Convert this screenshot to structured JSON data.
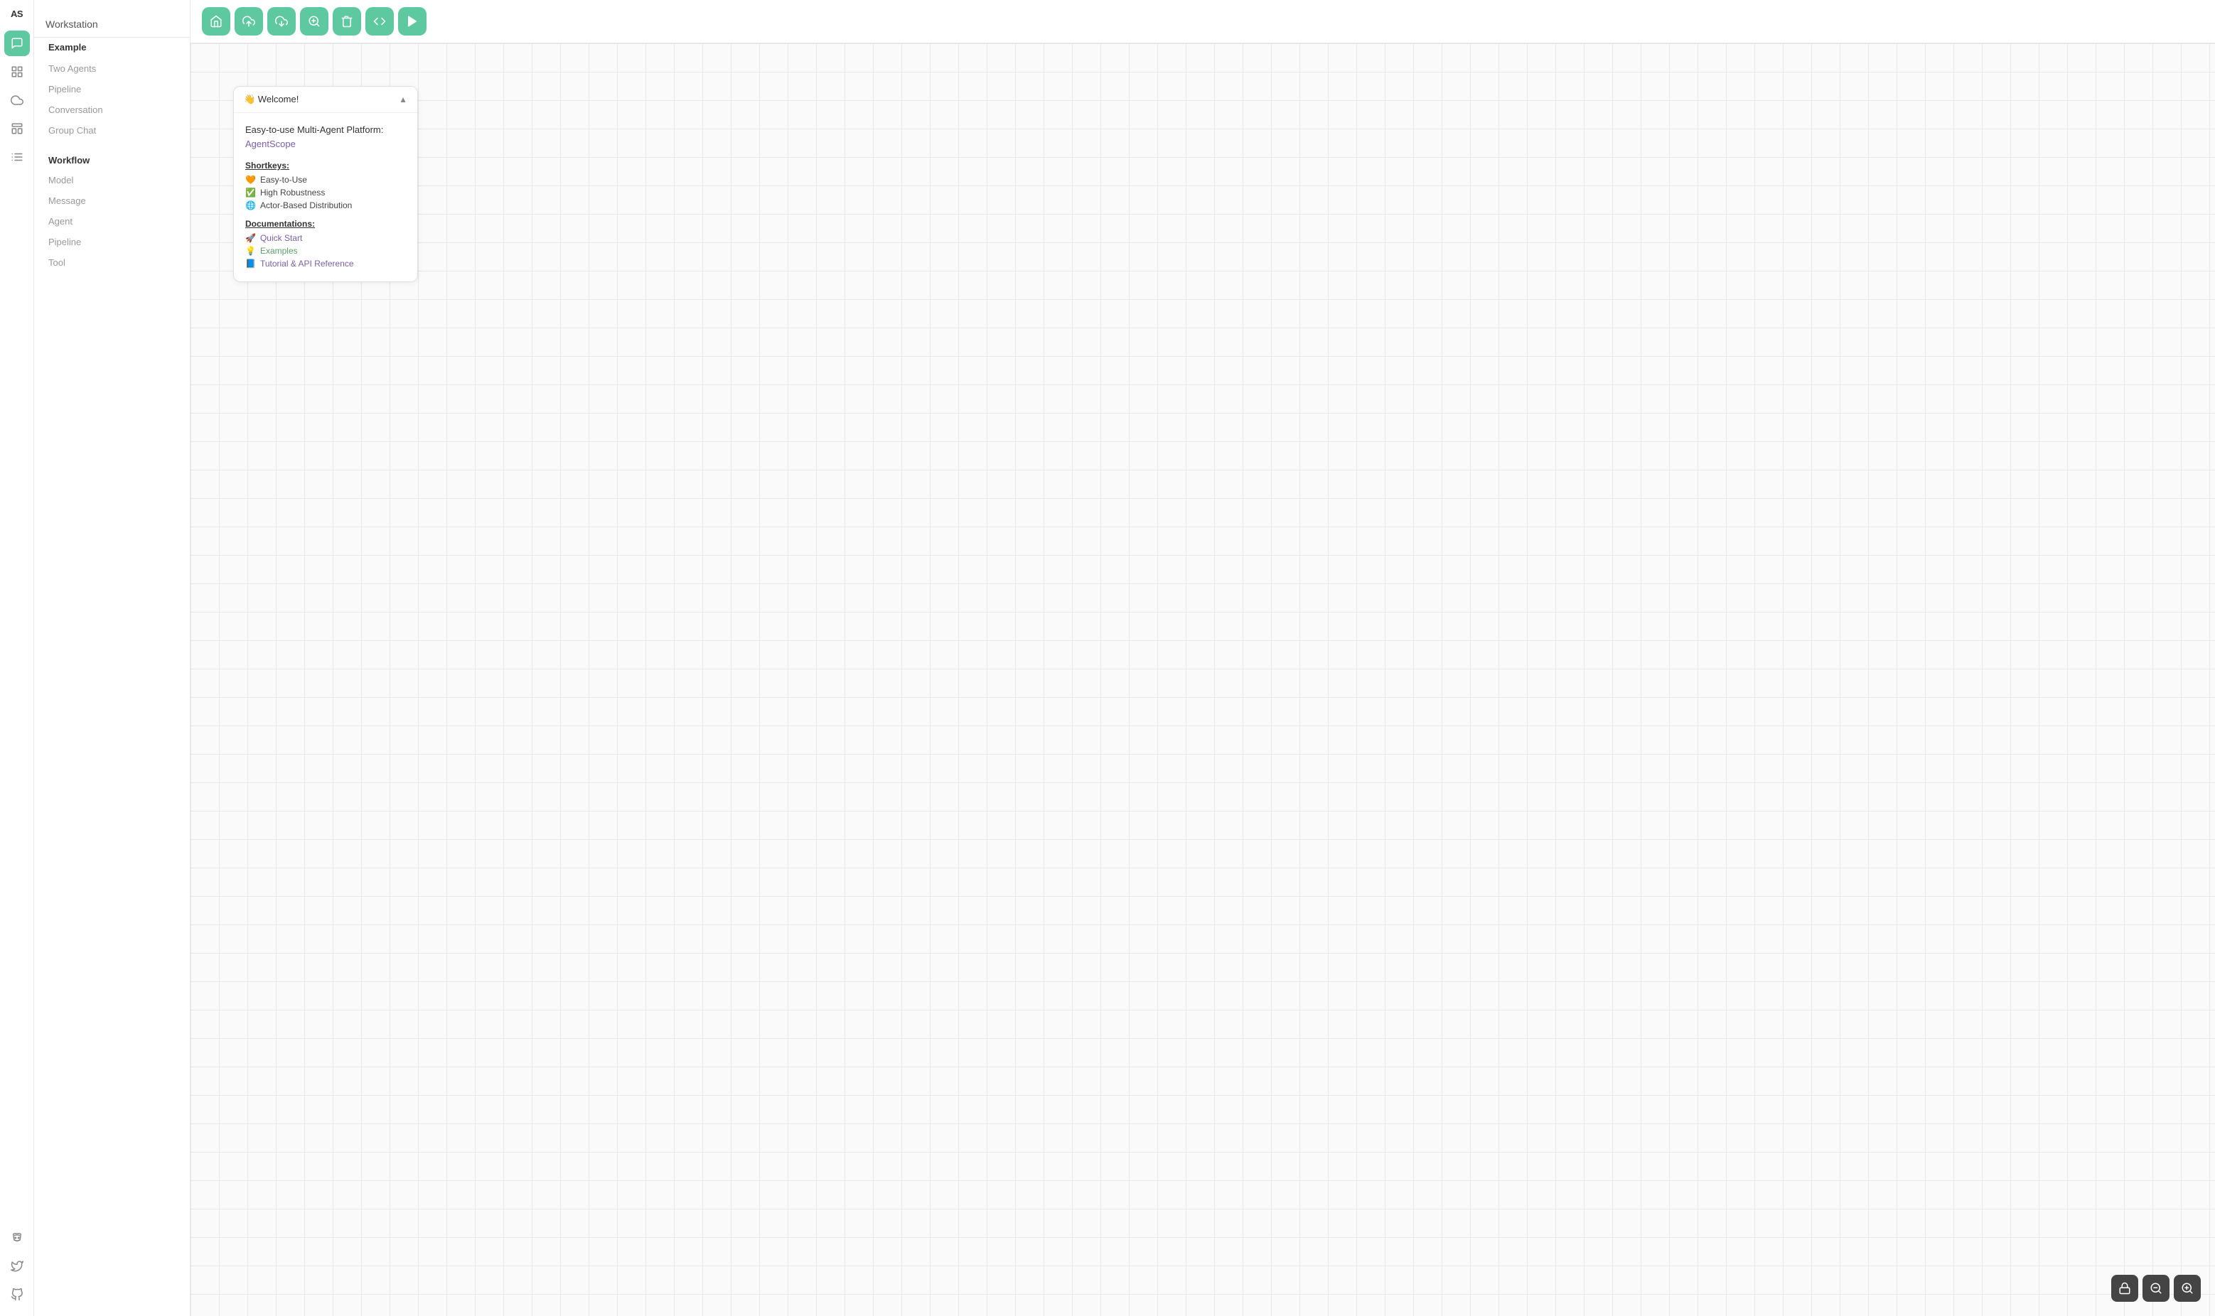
{
  "app": {
    "logo": "AS",
    "window_title": "Workstation"
  },
  "icon_sidebar": {
    "icons": [
      {
        "name": "chat-icon",
        "symbol": "💬",
        "active": true
      },
      {
        "name": "grid-icon",
        "symbol": "⊞",
        "active": false
      },
      {
        "name": "cloud-icon",
        "symbol": "☁",
        "active": false
      },
      {
        "name": "dashboard-icon",
        "symbol": "⊟",
        "active": false
      },
      {
        "name": "list-icon",
        "symbol": "☰",
        "active": false
      }
    ],
    "bottom_icons": [
      {
        "name": "discord-icon",
        "symbol": "🎮"
      },
      {
        "name": "bird-icon",
        "symbol": "🐦"
      },
      {
        "name": "github-icon",
        "symbol": "🐙"
      }
    ]
  },
  "sidebar": {
    "window_title": "Workstation",
    "example_section": {
      "label": "Example",
      "items": [
        {
          "label": "Two Agents"
        },
        {
          "label": "Pipeline"
        },
        {
          "label": "Conversation"
        },
        {
          "label": "Group Chat"
        }
      ]
    },
    "workflow_section": {
      "label": "Workflow",
      "items": [
        {
          "label": "Model"
        },
        {
          "label": "Message"
        },
        {
          "label": "Agent"
        },
        {
          "label": "Pipeline"
        },
        {
          "label": "Tool"
        }
      ]
    }
  },
  "toolbar": {
    "buttons": [
      {
        "name": "home-button",
        "label": "🏠"
      },
      {
        "name": "upload-button",
        "label": "⬆"
      },
      {
        "name": "download-button",
        "label": "⬇"
      },
      {
        "name": "zoom-fit-button",
        "label": "⊕"
      },
      {
        "name": "delete-button",
        "label": "🗑"
      },
      {
        "name": "code-button",
        "label": "<>"
      },
      {
        "name": "run-button",
        "label": "▶"
      }
    ]
  },
  "welcome_card": {
    "title": "👋 Welcome!",
    "collapse_icon": "▲",
    "headline_text": "Easy-to-use Multi-Agent Platform:",
    "headline_link_text": "AgentScope",
    "headline_link_url": "#",
    "shortkeys_label": "Shortkeys:",
    "shortkeys": [
      {
        "icon": "🧡",
        "text": "Easy-to-Use"
      },
      {
        "icon": "✅",
        "text": "High Robustness"
      },
      {
        "icon": "🌐",
        "text": "Actor-Based Distribution"
      }
    ],
    "docs_label": "Documentations:",
    "docs": [
      {
        "icon": "🚀",
        "text": "Quick Start",
        "color": "purple"
      },
      {
        "icon": "💡",
        "text": "Examples",
        "color": "green"
      },
      {
        "icon": "📘",
        "text": "Tutorial & API Reference",
        "color": "purple"
      }
    ]
  },
  "zoom_controls": {
    "lock_label": "🔒",
    "zoom_out_label": "−",
    "zoom_in_label": "+"
  }
}
